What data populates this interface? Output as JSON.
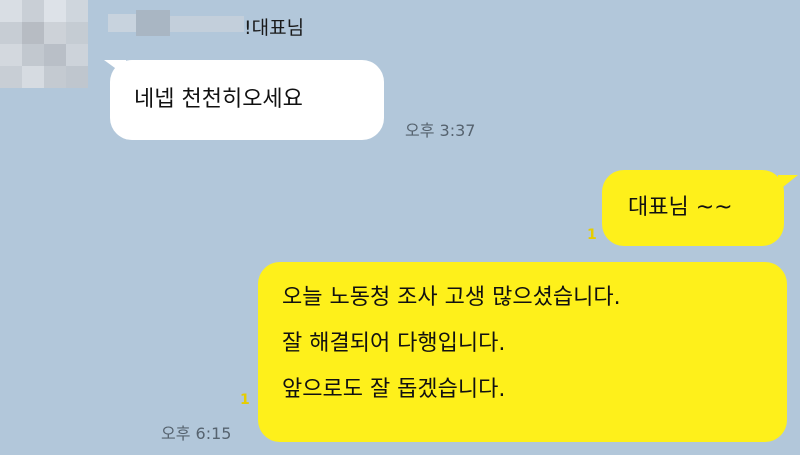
{
  "chat": {
    "sender_name": "!대표님",
    "messages": [
      {
        "text": "네넵 천천히오세요",
        "time": "오후 3:37"
      },
      {
        "text": "대표님 ~~",
        "unread": "1"
      },
      {
        "lines": [
          "오늘 노동청 조사 고생 많으셨습니다.",
          "잘 해결되어 다행입니다.",
          "앞으로도 잘 돕겠습니다."
        ],
        "unread": "1",
        "time": "오후 6:15"
      }
    ]
  },
  "colors": {
    "background": "#b2c7da",
    "incoming_bubble": "#ffffff",
    "outgoing_bubble": "#fef01b",
    "unread_count": "#e5cd00"
  }
}
